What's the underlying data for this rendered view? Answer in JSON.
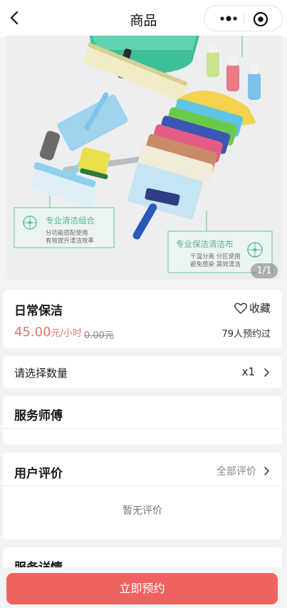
{
  "nav": {
    "title": "商品",
    "back_icon": "chevron-left-icon",
    "more_icon": "more-dots-icon",
    "close_icon": "target-close-icon"
  },
  "banner": {
    "counter": "1/1",
    "label_left": {
      "title": "专业清洁组合",
      "line1": "分功能搭配使用",
      "line2": "有效提升清洁效率"
    },
    "label_right": {
      "title": "专业保洁清洁布",
      "line1": "干湿分离 分区使用",
      "line2": "避免感染 高效清洁"
    }
  },
  "product": {
    "name": "日常保洁",
    "favorite_label": "收藏",
    "favorite_icon": "heart-outline-icon",
    "price": "45.00",
    "price_unit": "元/小时",
    "original_price": "0.00元",
    "booked_count": "79人预约过",
    "accent_color": "#e0786f"
  },
  "quantity": {
    "label": "请选择数量",
    "value": "x1"
  },
  "master": {
    "title": "服务师傅"
  },
  "reviews": {
    "title": "用户评价",
    "all_label": "全部评价",
    "empty_text": "暂无评价"
  },
  "details": {
    "title": "服务详情"
  },
  "cta": {
    "label": "立即预约",
    "color": "#ee6360"
  }
}
